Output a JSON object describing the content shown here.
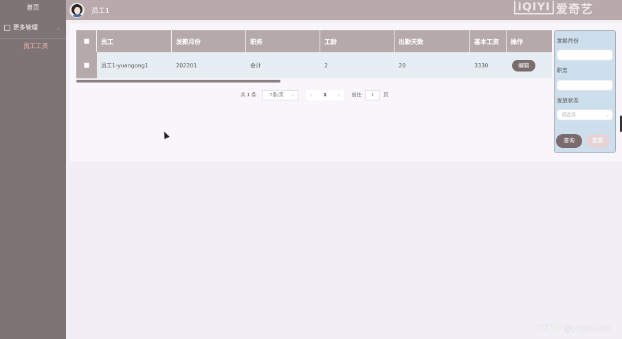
{
  "sidebar": {
    "home": "首页",
    "group": "更多管理",
    "sub_item": "员工工资"
  },
  "header": {
    "username": "员工1",
    "logo_box": "iQIYI",
    "logo_text": "爱奇艺"
  },
  "table": {
    "columns": [
      "员工",
      "发薪月份",
      "职务",
      "工龄",
      "出勤天数",
      "基本工资",
      "操作"
    ],
    "rows": [
      {
        "employee": "员工1-yuangong1",
        "month": "202201",
        "job": "会计",
        "years": "2",
        "days": "20",
        "base": "3330",
        "action": "编辑"
      }
    ]
  },
  "pager": {
    "total": "共 1 条",
    "page_size": "7条/页",
    "current": "1",
    "goto_label": "前往",
    "goto_value": "1",
    "page_unit": "页"
  },
  "search": {
    "month_label": "发薪月份",
    "job_label": "职务",
    "status_label": "发放状态",
    "status_placeholder": "请选择",
    "query_button": "查询",
    "reset_button": "重置"
  },
  "watermark": "CSDN @yuyuxun1"
}
